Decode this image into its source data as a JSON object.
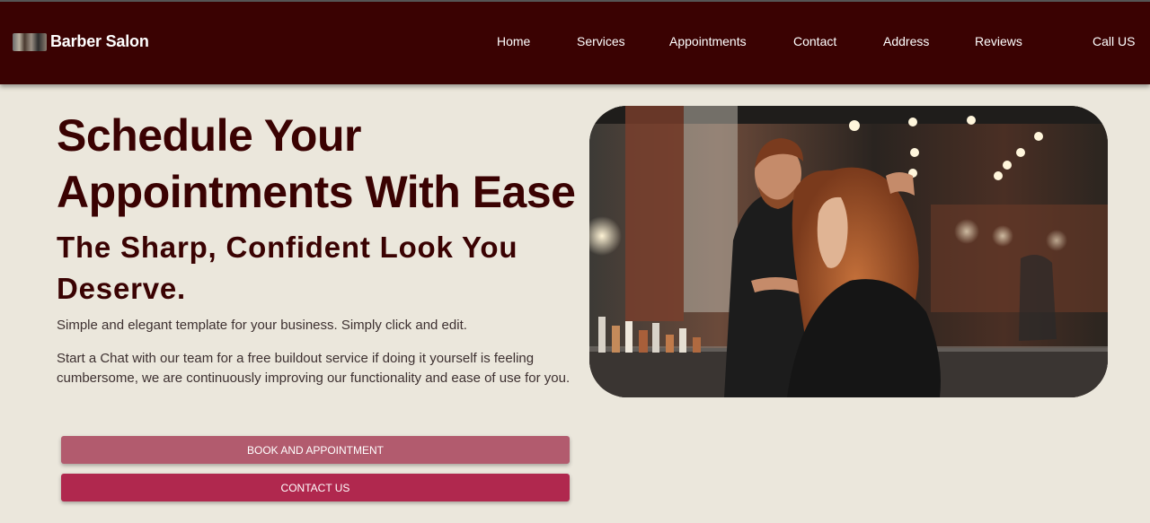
{
  "header": {
    "brand_name": "Barber Salon",
    "nav": [
      {
        "label": "Home"
      },
      {
        "label": "Services"
      },
      {
        "label": "Appointments"
      },
      {
        "label": "Contact"
      },
      {
        "label": "Address"
      },
      {
        "label": "Reviews"
      },
      {
        "label": "Call US"
      }
    ]
  },
  "hero": {
    "title": "Schedule Your Appointments With Ease",
    "subtitle": "The Sharp, Confident Look You Deserve.",
    "paragraph_1": "Simple and elegant template for your business. Simply click and edit.",
    "paragraph_2": "Start a Chat with our team for a free buildout service if doing it yourself is feeling cumbersome, we are continuously improving our functionality and ease of use for you.",
    "book_button": "BOOK AND APPOINTMENT",
    "contact_button": "CONTACT US"
  },
  "colors": {
    "navbar_bg": "#3a0202",
    "page_bg": "#ebe7dc",
    "heading": "#3a0202",
    "book_button_bg": "#b25b6e",
    "contact_button_bg": "#b0284e"
  }
}
